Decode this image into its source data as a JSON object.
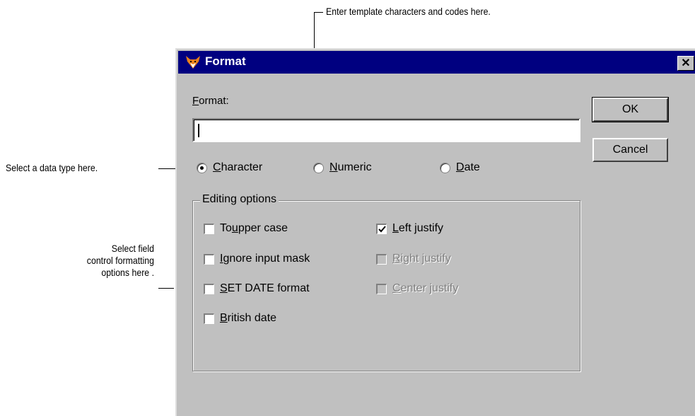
{
  "annotations": {
    "template": "Enter template characters and codes here.",
    "data_type": "Select a data type here.",
    "formatting": [
      "Select field",
      "control formatting",
      "options here ."
    ]
  },
  "dialog": {
    "title": "Format",
    "app_icon": "fox-icon",
    "close_glyph": "✕",
    "format_label_first": "F",
    "format_label_rest": "ormat:",
    "format_value": "",
    "ok_label": "OK",
    "cancel_label": "Cancel"
  },
  "data_types": [
    {
      "first": "C",
      "rest": "haracter",
      "checked": true
    },
    {
      "first": "N",
      "rest": "umeric",
      "checked": false
    },
    {
      "first": "D",
      "rest": "ate",
      "checked": false
    }
  ],
  "editing_options": {
    "legend": "Editing options",
    "to_upper": {
      "pre": "To ",
      "u": "u",
      "post": "pper case",
      "checked": false
    },
    "ignore_mask": {
      "pre": "",
      "u": "I",
      "post": "gnore input mask",
      "checked": false
    },
    "set_date": {
      "pre": "",
      "u": "S",
      "post": "ET DATE format",
      "checked": false
    },
    "british": {
      "pre": "",
      "u": "B",
      "post": "ritish date",
      "checked": false
    },
    "left_justify": {
      "pre": "",
      "u": "L",
      "post": "eft justify",
      "checked": true,
      "enabled": true
    },
    "right_justify": {
      "pre": "",
      "u": "R",
      "post": "ight justify",
      "checked": false,
      "enabled": false
    },
    "center_justify": {
      "pre": "",
      "u": "C",
      "post": "enter justify",
      "checked": false,
      "enabled": false
    }
  }
}
